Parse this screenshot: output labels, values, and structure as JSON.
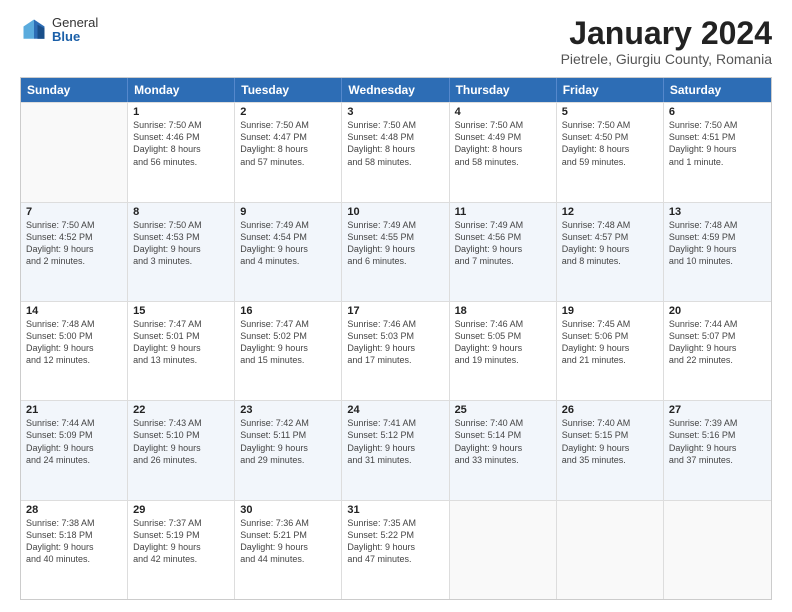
{
  "logo": {
    "general": "General",
    "blue": "Blue"
  },
  "title": {
    "month_year": "January 2024",
    "location": "Pietrele, Giurgiu County, Romania"
  },
  "weekdays": [
    "Sunday",
    "Monday",
    "Tuesday",
    "Wednesday",
    "Thursday",
    "Friday",
    "Saturday"
  ],
  "rows": [
    {
      "alt": false,
      "cells": [
        {
          "day": "",
          "info": ""
        },
        {
          "day": "1",
          "info": "Sunrise: 7:50 AM\nSunset: 4:46 PM\nDaylight: 8 hours\nand 56 minutes."
        },
        {
          "day": "2",
          "info": "Sunrise: 7:50 AM\nSunset: 4:47 PM\nDaylight: 8 hours\nand 57 minutes."
        },
        {
          "day": "3",
          "info": "Sunrise: 7:50 AM\nSunset: 4:48 PM\nDaylight: 8 hours\nand 58 minutes."
        },
        {
          "day": "4",
          "info": "Sunrise: 7:50 AM\nSunset: 4:49 PM\nDaylight: 8 hours\nand 58 minutes."
        },
        {
          "day": "5",
          "info": "Sunrise: 7:50 AM\nSunset: 4:50 PM\nDaylight: 8 hours\nand 59 minutes."
        },
        {
          "day": "6",
          "info": "Sunrise: 7:50 AM\nSunset: 4:51 PM\nDaylight: 9 hours\nand 1 minute."
        }
      ]
    },
    {
      "alt": true,
      "cells": [
        {
          "day": "7",
          "info": "Sunrise: 7:50 AM\nSunset: 4:52 PM\nDaylight: 9 hours\nand 2 minutes."
        },
        {
          "day": "8",
          "info": "Sunrise: 7:50 AM\nSunset: 4:53 PM\nDaylight: 9 hours\nand 3 minutes."
        },
        {
          "day": "9",
          "info": "Sunrise: 7:49 AM\nSunset: 4:54 PM\nDaylight: 9 hours\nand 4 minutes."
        },
        {
          "day": "10",
          "info": "Sunrise: 7:49 AM\nSunset: 4:55 PM\nDaylight: 9 hours\nand 6 minutes."
        },
        {
          "day": "11",
          "info": "Sunrise: 7:49 AM\nSunset: 4:56 PM\nDaylight: 9 hours\nand 7 minutes."
        },
        {
          "day": "12",
          "info": "Sunrise: 7:48 AM\nSunset: 4:57 PM\nDaylight: 9 hours\nand 8 minutes."
        },
        {
          "day": "13",
          "info": "Sunrise: 7:48 AM\nSunset: 4:59 PM\nDaylight: 9 hours\nand 10 minutes."
        }
      ]
    },
    {
      "alt": false,
      "cells": [
        {
          "day": "14",
          "info": "Sunrise: 7:48 AM\nSunset: 5:00 PM\nDaylight: 9 hours\nand 12 minutes."
        },
        {
          "day": "15",
          "info": "Sunrise: 7:47 AM\nSunset: 5:01 PM\nDaylight: 9 hours\nand 13 minutes."
        },
        {
          "day": "16",
          "info": "Sunrise: 7:47 AM\nSunset: 5:02 PM\nDaylight: 9 hours\nand 15 minutes."
        },
        {
          "day": "17",
          "info": "Sunrise: 7:46 AM\nSunset: 5:03 PM\nDaylight: 9 hours\nand 17 minutes."
        },
        {
          "day": "18",
          "info": "Sunrise: 7:46 AM\nSunset: 5:05 PM\nDaylight: 9 hours\nand 19 minutes."
        },
        {
          "day": "19",
          "info": "Sunrise: 7:45 AM\nSunset: 5:06 PM\nDaylight: 9 hours\nand 21 minutes."
        },
        {
          "day": "20",
          "info": "Sunrise: 7:44 AM\nSunset: 5:07 PM\nDaylight: 9 hours\nand 22 minutes."
        }
      ]
    },
    {
      "alt": true,
      "cells": [
        {
          "day": "21",
          "info": "Sunrise: 7:44 AM\nSunset: 5:09 PM\nDaylight: 9 hours\nand 24 minutes."
        },
        {
          "day": "22",
          "info": "Sunrise: 7:43 AM\nSunset: 5:10 PM\nDaylight: 9 hours\nand 26 minutes."
        },
        {
          "day": "23",
          "info": "Sunrise: 7:42 AM\nSunset: 5:11 PM\nDaylight: 9 hours\nand 29 minutes."
        },
        {
          "day": "24",
          "info": "Sunrise: 7:41 AM\nSunset: 5:12 PM\nDaylight: 9 hours\nand 31 minutes."
        },
        {
          "day": "25",
          "info": "Sunrise: 7:40 AM\nSunset: 5:14 PM\nDaylight: 9 hours\nand 33 minutes."
        },
        {
          "day": "26",
          "info": "Sunrise: 7:40 AM\nSunset: 5:15 PM\nDaylight: 9 hours\nand 35 minutes."
        },
        {
          "day": "27",
          "info": "Sunrise: 7:39 AM\nSunset: 5:16 PM\nDaylight: 9 hours\nand 37 minutes."
        }
      ]
    },
    {
      "alt": false,
      "cells": [
        {
          "day": "28",
          "info": "Sunrise: 7:38 AM\nSunset: 5:18 PM\nDaylight: 9 hours\nand 40 minutes."
        },
        {
          "day": "29",
          "info": "Sunrise: 7:37 AM\nSunset: 5:19 PM\nDaylight: 9 hours\nand 42 minutes."
        },
        {
          "day": "30",
          "info": "Sunrise: 7:36 AM\nSunset: 5:21 PM\nDaylight: 9 hours\nand 44 minutes."
        },
        {
          "day": "31",
          "info": "Sunrise: 7:35 AM\nSunset: 5:22 PM\nDaylight: 9 hours\nand 47 minutes."
        },
        {
          "day": "",
          "info": ""
        },
        {
          "day": "",
          "info": ""
        },
        {
          "day": "",
          "info": ""
        }
      ]
    }
  ]
}
